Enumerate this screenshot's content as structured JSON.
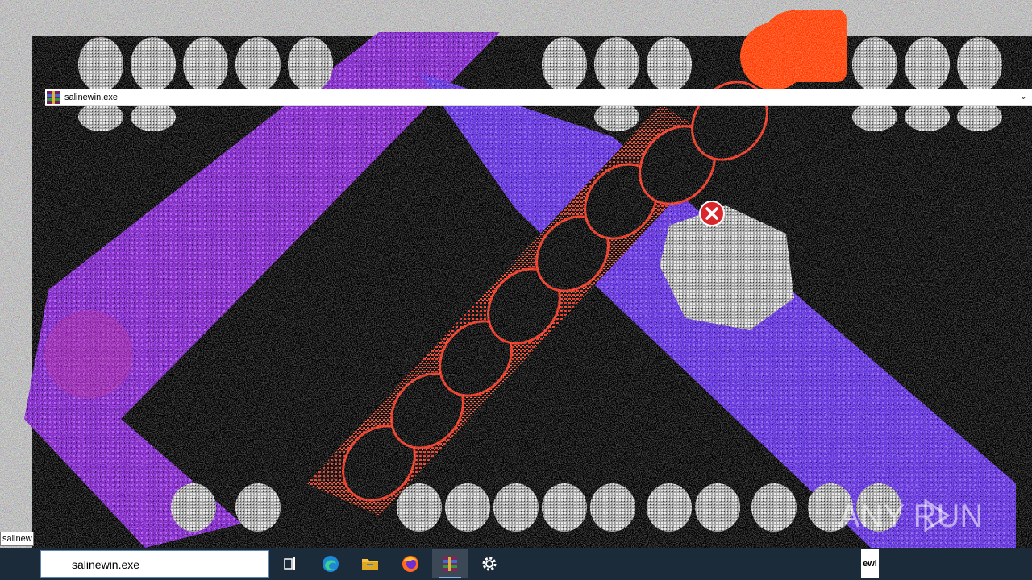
{
  "window": {
    "title": "salinewin.exe"
  },
  "tooltip_label": "salinew",
  "taskbar": {
    "search_value": "salinewin.exe",
    "items": [
      "task-view",
      "edge",
      "file-explorer",
      "firefox",
      "winrar",
      "settings"
    ],
    "active_item": "winrar",
    "tray_fragment": "ewi"
  },
  "watermark": {
    "brand": "ANY RUN"
  },
  "colors": {
    "purple": "#8e2bd6",
    "red": "#e8301a",
    "accent": "#ff3c00",
    "taskbar": "#1c2b3a"
  }
}
